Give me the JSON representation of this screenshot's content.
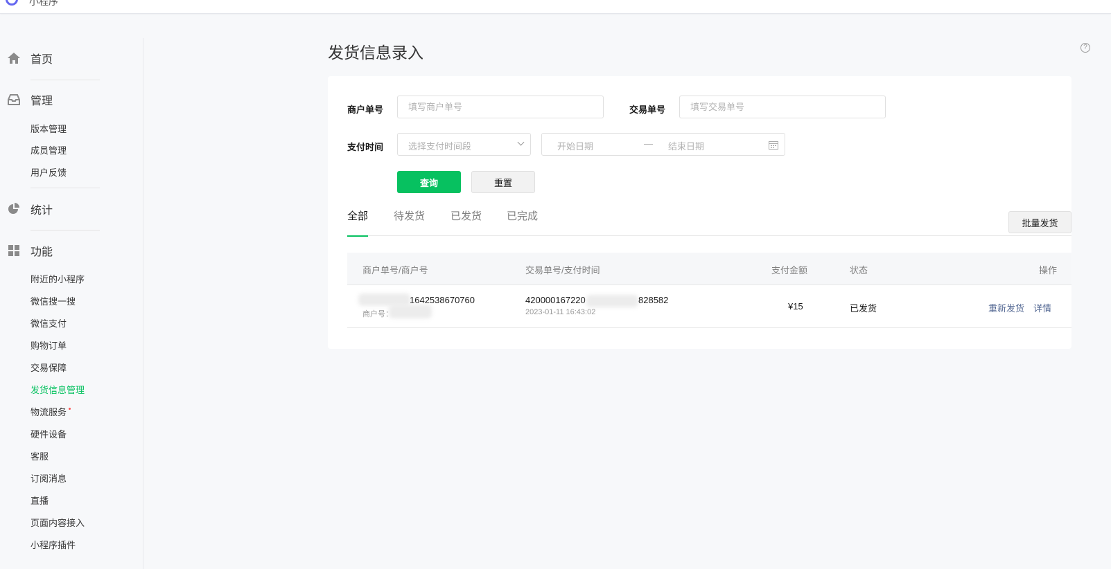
{
  "header": {
    "brand": "小程序"
  },
  "sidebar": {
    "groups": [
      {
        "label": "首页",
        "icon": "home-icon"
      },
      {
        "label": "管理",
        "icon": "inbox-icon",
        "items": [
          "版本管理",
          "成员管理",
          "用户反馈"
        ]
      },
      {
        "label": "统计",
        "icon": "pie-chart-icon"
      },
      {
        "label": "功能",
        "icon": "grid-icon",
        "items": [
          "附近的小程序",
          "微信搜一搜",
          "微信支付",
          "购物订单",
          "交易保障",
          "发货信息管理",
          "物流服务",
          "硬件设备",
          "客服",
          "订阅消息",
          "直播",
          "页面内容接入",
          "小程序插件"
        ]
      }
    ],
    "active_item": "发货信息管理"
  },
  "main": {
    "title": "发货信息录入",
    "filters": {
      "merchant_label": "商户单号",
      "merchant_placeholder": "填写商户单号",
      "trade_label": "交易单号",
      "trade_placeholder": "填写交易单号",
      "paytime_label": "支付时间",
      "paytime_select_placeholder": "选择支付时间段",
      "date_start": "开始日期",
      "date_sep": "—",
      "date_end": "结束日期",
      "query_button": "查询",
      "reset_button": "重置"
    },
    "tabs": [
      "全部",
      "待发货",
      "已发货",
      "已完成"
    ],
    "active_tab": "全部",
    "batch_button": "批量发货",
    "table": {
      "columns": [
        "商户单号/商户号",
        "交易单号/支付时间",
        "支付金额",
        "状态",
        "操作"
      ],
      "rows": [
        {
          "merchant_no_visible": "1642538670760",
          "merchant_sub_prefix": "商户号：",
          "trade_no_prefix": "420000167220",
          "trade_no_suffix": "828582",
          "pay_time": "2023-01-11 16:43:02",
          "amount": "¥15",
          "status": "已发货",
          "actions": [
            "重新发货",
            "详情"
          ]
        }
      ]
    }
  },
  "colors": {
    "accent": "#07c160",
    "link": "#576b95",
    "page_bg": "#f7f8fa"
  }
}
